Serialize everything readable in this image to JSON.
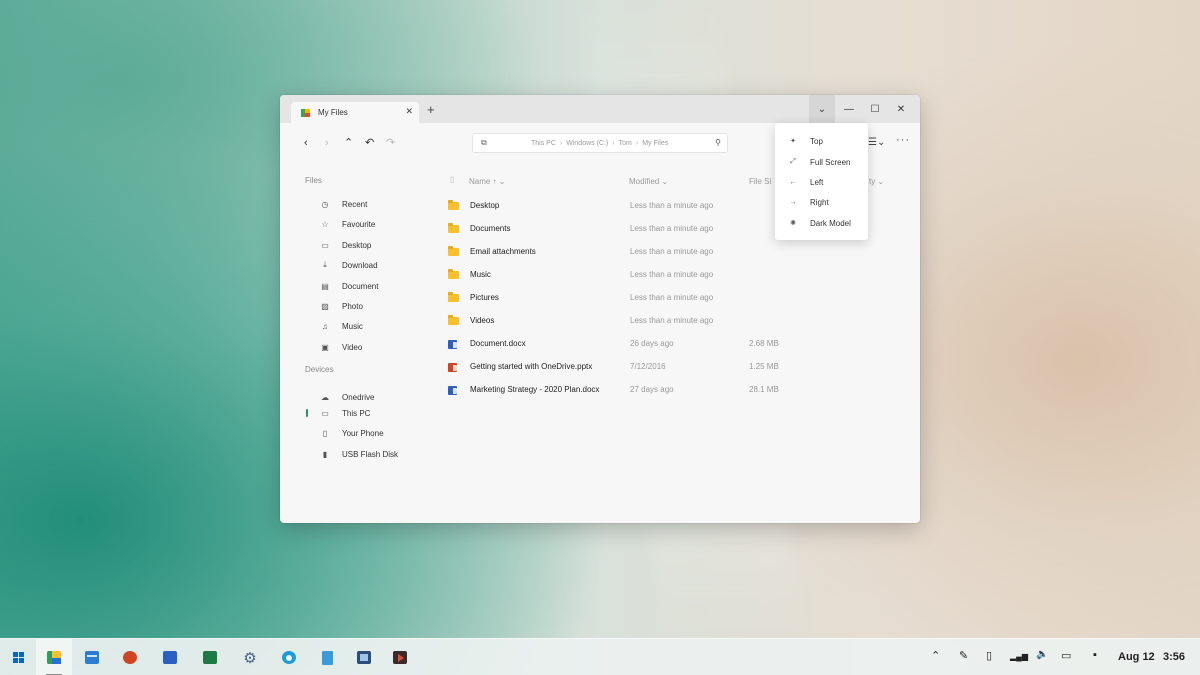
{
  "window": {
    "tab_title": "My Files",
    "tab_close": "✕",
    "new_tab": "+",
    "controls": {
      "dropdown": "⌄",
      "minimize": "—",
      "maximize": "☐",
      "close": "✕"
    }
  },
  "toolbar": {
    "back": "‹",
    "forward": "›",
    "up": "⌃",
    "undo": "↶",
    "redo": "↷",
    "address_parts": [
      "This PC",
      "Windows (C:)",
      "Tom",
      "My Files"
    ],
    "address_sep": "›",
    "view_icon": "☰⌄",
    "more": "···"
  },
  "sidebar": {
    "files_title": "Files",
    "files": [
      {
        "label": "Recent",
        "icon": "clock-icon",
        "glyph": "◷"
      },
      {
        "label": "Favourite",
        "icon": "star-icon",
        "glyph": "☆"
      },
      {
        "label": "Desktop",
        "icon": "monitor-icon",
        "glyph": "▭"
      },
      {
        "label": "Download",
        "icon": "download-icon",
        "glyph": "⤓"
      },
      {
        "label": "Document",
        "icon": "document-icon",
        "glyph": "▤"
      },
      {
        "label": "Photo",
        "icon": "photo-icon",
        "glyph": "▨"
      },
      {
        "label": "Music",
        "icon": "music-icon",
        "glyph": "♫"
      },
      {
        "label": "Video",
        "icon": "video-icon",
        "glyph": "▣"
      }
    ],
    "devices_title": "Devices",
    "devices": [
      {
        "label": "Onedrive",
        "icon": "cloud-icon",
        "glyph": "☁"
      },
      {
        "label": "This PC",
        "icon": "pc-icon",
        "glyph": "▭"
      },
      {
        "label": "Your Phone",
        "icon": "phone-icon",
        "glyph": "▯"
      },
      {
        "label": "USB Flash Disk",
        "icon": "usb-icon",
        "glyph": "▮"
      }
    ],
    "active_device": "This PC"
  },
  "list": {
    "columns": {
      "name": "Name ↑ ⌄",
      "modified": "Modified ⌄",
      "size": "File Si",
      "extra": "ty ⌄"
    },
    "rows": [
      {
        "name": "Desktop",
        "type": "folder",
        "modified": "Less than a minute ago",
        "size": ""
      },
      {
        "name": "Documents",
        "type": "folder",
        "modified": "Less than a minute ago",
        "size": ""
      },
      {
        "name": "Email attachments",
        "type": "folder",
        "modified": "Less than a minute ago",
        "size": ""
      },
      {
        "name": "Music",
        "type": "folder",
        "modified": "Less than a minute ago",
        "size": ""
      },
      {
        "name": "Pictures",
        "type": "folder",
        "modified": "Less than a minute ago",
        "size": ""
      },
      {
        "name": "Videos",
        "type": "folder",
        "modified": "Less than a minute ago",
        "size": ""
      },
      {
        "name": "Document.docx",
        "type": "word",
        "modified": "26 days ago",
        "size": "2.68 MB"
      },
      {
        "name": "Getting started with OneDrive.pptx",
        "type": "ppt",
        "modified": "7/12/2016",
        "size": "1.25 MB"
      },
      {
        "name": "Marketing Strategy - 2020 Plan.docx",
        "type": "word",
        "modified": "27 days ago",
        "size": "28.1 MB"
      }
    ]
  },
  "menu": {
    "items": [
      {
        "label": "Top",
        "icon": "pin-icon",
        "glyph": "✦"
      },
      {
        "label": "Full Screen",
        "icon": "expand-icon",
        "glyph": "⤢"
      },
      {
        "label": "Left",
        "icon": "arrow-left-icon",
        "glyph": "←"
      },
      {
        "label": "Right",
        "icon": "arrow-right-icon",
        "glyph": "→"
      },
      {
        "label": "Dark Model",
        "icon": "brightness-icon",
        "glyph": "✺"
      }
    ]
  },
  "taskbar": {
    "apps": [
      "start",
      "file-explorer",
      "mail",
      "powerpoint",
      "word",
      "excel",
      "settings",
      "edge",
      "notepad",
      "photos",
      "media-player"
    ],
    "tray": {
      "chevron": "⌃",
      "pen": "✎",
      "battery_saver": "▯",
      "signal": "▂▄▆",
      "volume": "🔈",
      "battery": "▭",
      "notification": "▪"
    },
    "date": "Aug 12",
    "time": "3:56"
  },
  "colors": {
    "accent": "#2f8f6a",
    "folder": "#f8c12b",
    "word": "#2b5fc1",
    "ppt": "#d04423"
  }
}
